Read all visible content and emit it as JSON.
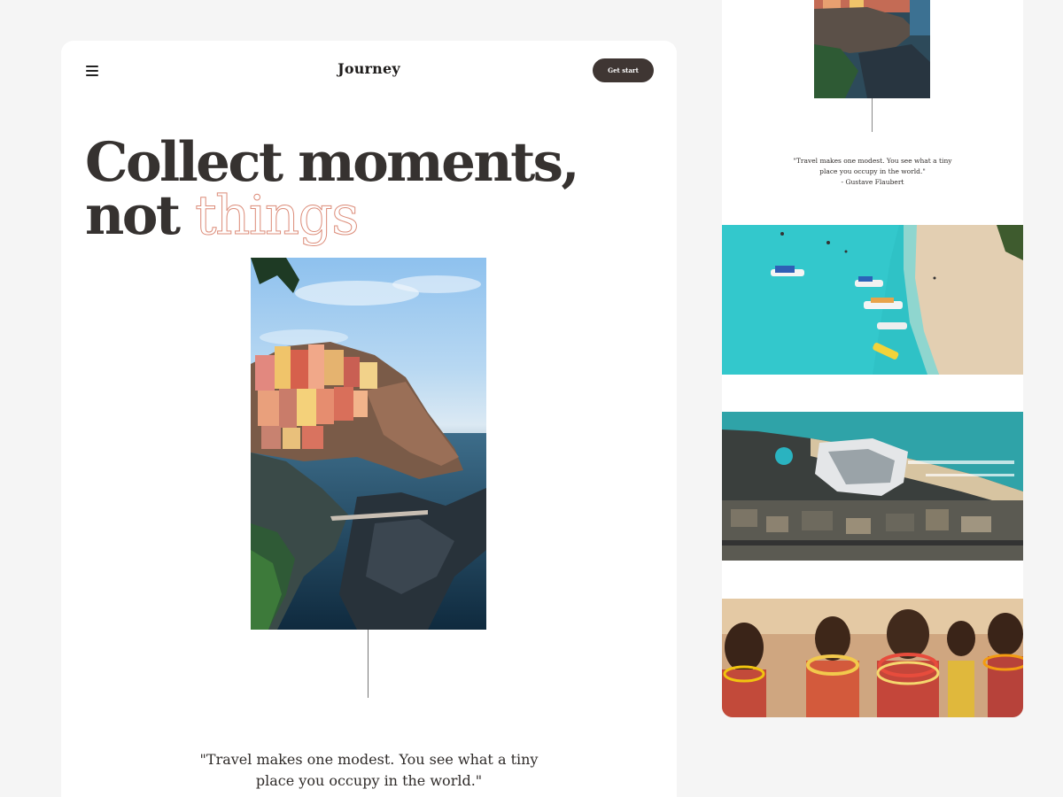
{
  "header": {
    "brand": "Journey",
    "cta_label": "Get start"
  },
  "hero": {
    "title_line1": "Collect moments,",
    "title_line2_plain": "not",
    "title_line2_outline": "things",
    "outline_color": "#dc8c79"
  },
  "quote": {
    "line1": "\"Travel makes one modest. You see what a tiny",
    "line2": "place you occupy in the world.\"",
    "author": "- Gustave Flaubert"
  },
  "colors": {
    "background": "#f5f5f5",
    "card": "#ffffff",
    "text": "#363230",
    "button": "#3f3633"
  },
  "icons": {
    "menu": "hamburger-menu-icon"
  }
}
